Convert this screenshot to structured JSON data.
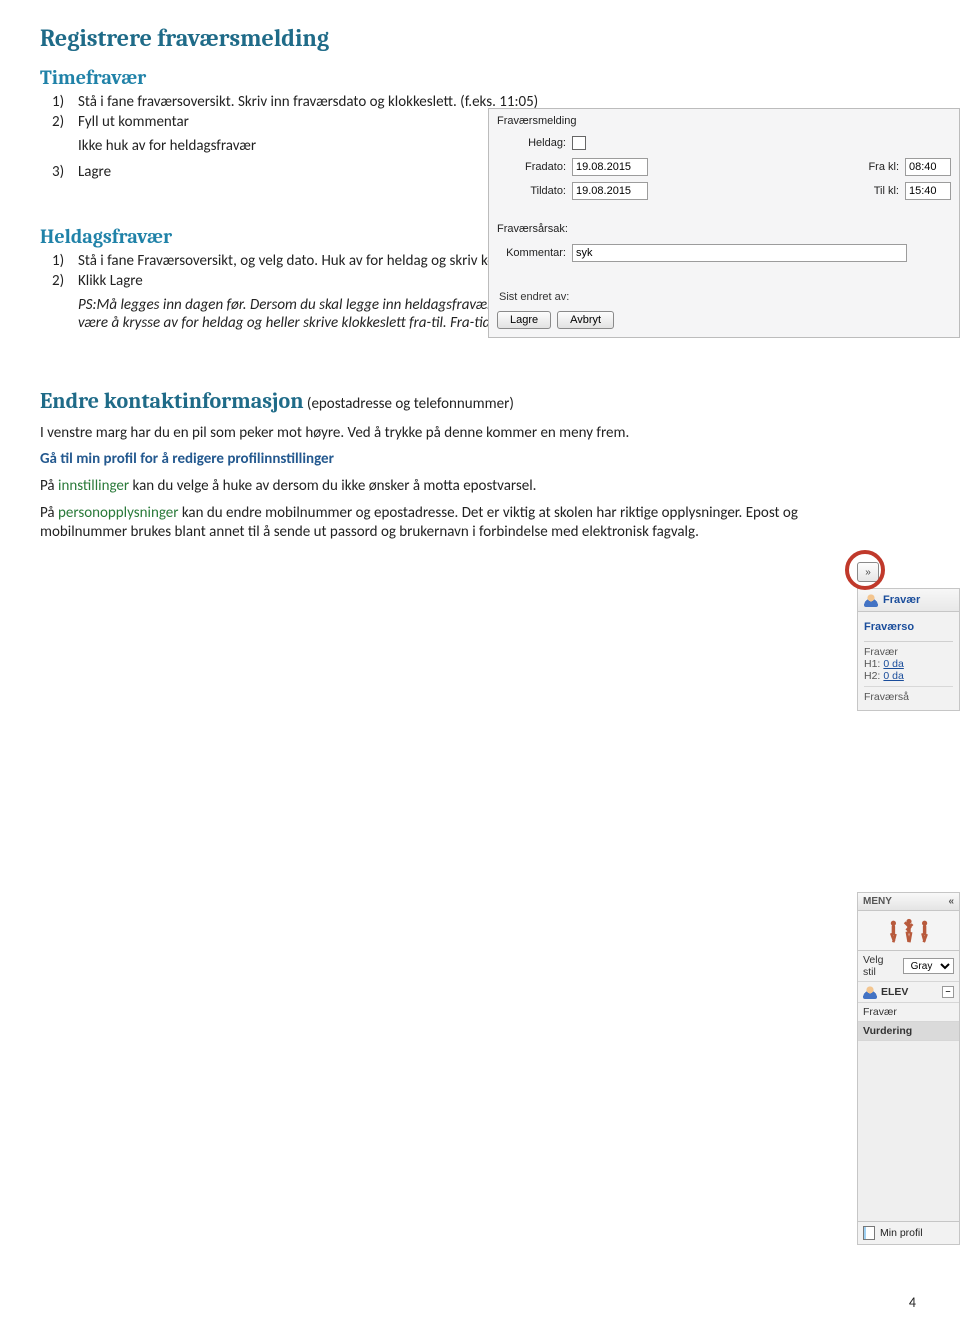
{
  "heading_main": "Registrere fraværsmelding",
  "section1": {
    "title": "Timefravær",
    "item1": "Stå i fane fraværsoversikt. Skriv inn fraværsdato og klokkeslett. (f.eks. 11:05)",
    "item2": "Fyll ut kommentar",
    "note": "Ikke huk av for heldagsfravær",
    "item3": "Lagre"
  },
  "section2": {
    "title": "Heldagsfravær",
    "item1": "Stå i fane Fraværsoversikt, og velg dato. Huk av for heldag og skriv kommentar",
    "item2": "Klikk Lagre",
    "ps_italic": "PS:Må legges inn dagen før. Dersom du skal legge inn heldagsfravær samme dag (for eksempel tidlig på morgenen) må du la være å krysse av for heldag og heller skrive klokkeslett fra-til. Fra-tiden må være et tidspunkt frem i tid."
  },
  "section3": {
    "title": "Endre kontaktinformasjon",
    "title_suffix": " (epostadresse og telefonnummer)",
    "p1": "I venstre marg har du en pil som peker mot høyre. Ved å trykke på denne kommer en meny frem.",
    "p2": "Gå til min profil for å redigere profilinnstillinger",
    "p3_pre": "På ",
    "p3_link": "innstillinger",
    "p3_post": " kan du velge å huke av dersom du ikke ønsker å motta epostvarsel.",
    "p4_pre": "På ",
    "p4_link": "personopplysninger",
    "p4_post": " kan du endre mobilnummer og epostadresse. Det er viktig at skolen har riktige opplysninger. Epost og mobilnummer brukes blant annet til å sende ut passord og brukernavn i forbindelse med elektronisk fagvalg."
  },
  "form": {
    "title": "Fraværsmelding",
    "labels": {
      "heldag": "Heldag:",
      "fradato": "Fradato:",
      "tildato": "Tildato:",
      "frakl": "Fra kl:",
      "tilkl": "Til kl:",
      "arsak": "Fraværsårsak:",
      "kommentar": "Kommentar:",
      "sist": "Sist endret av:"
    },
    "values": {
      "fradato": "19.08.2015",
      "tildato": "19.08.2015",
      "frakl": "08:40",
      "tilkl": "15:40",
      "kommentar": "syk"
    },
    "buttons": {
      "lagre": "Lagre",
      "avbryt": "Avbryt"
    }
  },
  "fravar_panel": {
    "head": "Fravær",
    "rows": {
      "oversikt": "Fraværso",
      "fravar": "Fravær",
      "h1_label": "H1:",
      "h1_val": "0 da",
      "h2_label": "H2:",
      "h2_val": "0 da",
      "arsak": "Fraværså"
    }
  },
  "meny": {
    "title": "MENY",
    "velg_stil": "Velg stil",
    "velg_stil_value": "Gray",
    "elev": "ELEV",
    "fravar": "Fravær",
    "vurdering": "Vurdering",
    "min_profil": "Min profil"
  },
  "page_number": "4"
}
